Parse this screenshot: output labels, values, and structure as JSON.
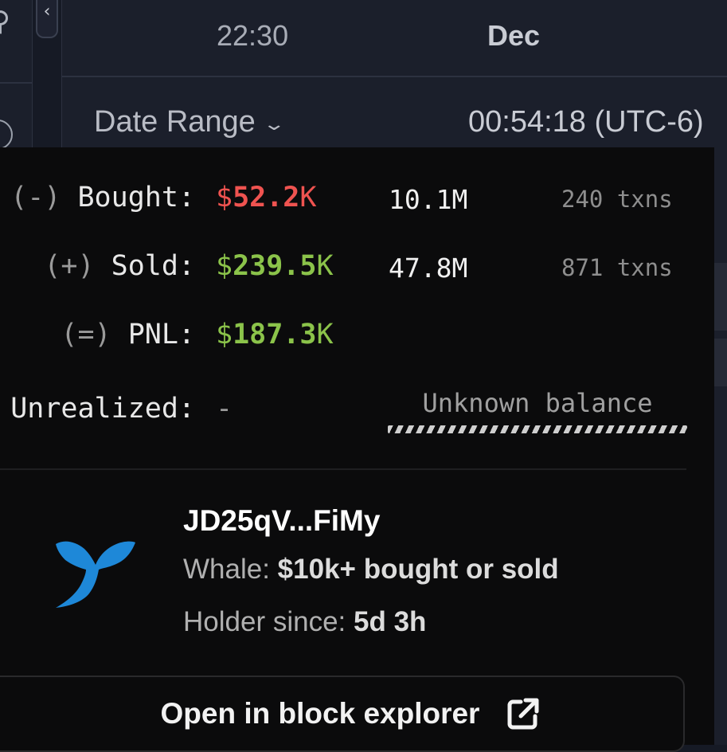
{
  "header": {
    "time": "22:30",
    "month": "Dec",
    "date_range_label": "Date Range",
    "clock": "00:54:18 (UTC-6)"
  },
  "stats": {
    "bought": {
      "prefix": "(-)",
      "label": "Bought:",
      "currency": "$",
      "amount": "52.2",
      "unit": "K",
      "tokens": "10.1M",
      "txns": "240 txns",
      "color": "#ef5350"
    },
    "sold": {
      "prefix": "(+)",
      "label": "Sold:",
      "currency": "$",
      "amount": "239.5",
      "unit": "K",
      "tokens": "47.8M",
      "txns": "871 txns",
      "color": "#8bc34a"
    },
    "pnl": {
      "prefix": "(=)",
      "label": "PNL:",
      "currency": "$",
      "amount": "187.3",
      "unit": "K",
      "color": "#8bc34a"
    },
    "unrealized": {
      "label": "Unrealized:",
      "value": "-",
      "balance_note": "Unknown balance"
    }
  },
  "wallet": {
    "address": "JD25qV...FiMy",
    "whale_label": "Whale:",
    "whale_value": "$10k+ bought or sold",
    "holder_label": "Holder since:",
    "holder_value": "5d 3h",
    "icon": "whale-tail-icon",
    "icon_color": "#1e88d8"
  },
  "actions": {
    "open_explorer_label": "Open in block explorer",
    "open_explorer_icon": "external-link-icon"
  }
}
